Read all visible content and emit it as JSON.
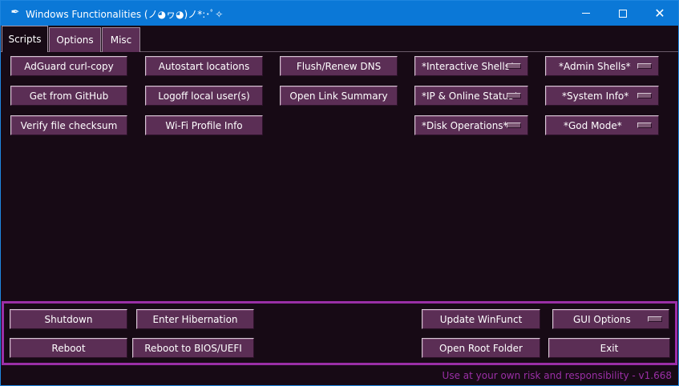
{
  "window": {
    "title": "Windows Functionalities (ノ◕ヮ◕)ノ*:･ﾟ✧",
    "icon": "feather-icon",
    "controls": {
      "minimize": "minimize-icon",
      "maximize": "maximize-icon",
      "close": "close-icon"
    }
  },
  "tabs": [
    {
      "label": "Scripts",
      "active": true
    },
    {
      "label": "Options",
      "active": false
    },
    {
      "label": "Misc",
      "active": false
    }
  ],
  "scripts": {
    "col1": [
      "AdGuard curl-copy",
      "Get from GitHub",
      "Verify file checksum"
    ],
    "col2": [
      "Autostart locations",
      "Logoff local user(s)",
      "Wi-Fi Profile Info"
    ],
    "col3": [
      "Flush/Renew DNS",
      "Open Link Summary"
    ],
    "col4_menus": [
      "*Interactive Shells*",
      "*IP & Online Status*",
      "*Disk Operations*"
    ],
    "col5_menus": [
      "*Admin Shells*",
      "*System Info*",
      "*God Mode*"
    ]
  },
  "bottom": {
    "shutdown": "Shutdown",
    "hibernate": "Enter Hibernation",
    "reboot": "Reboot",
    "reboot_bios": "Reboot to BIOS/UEFI",
    "update": "Update WinFunct",
    "open_root": "Open Root Folder",
    "gui_options": "GUI Options",
    "exit": "Exit"
  },
  "footer": "Use at your own risk and responsibility - v1.668",
  "colors": {
    "titlebar": "#0b78d7",
    "background": "#170a15",
    "button": "#5b2e55",
    "accent_frame": "#9a2fa6",
    "footer_text": "#9a2fa6"
  }
}
